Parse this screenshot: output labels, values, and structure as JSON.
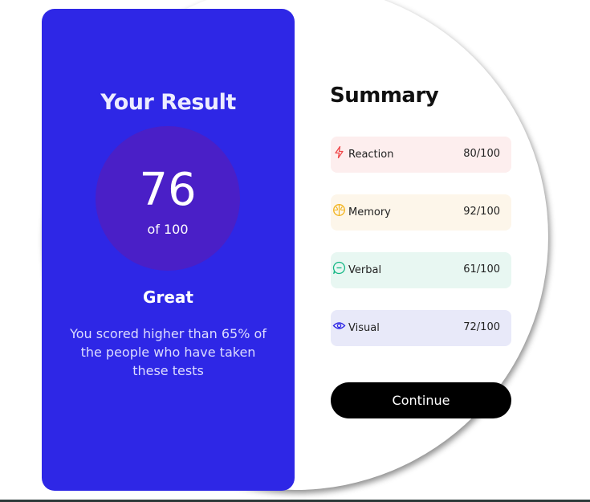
{
  "result": {
    "title": "Your Result",
    "score": "76",
    "score_of": "of 100",
    "rating": "Great",
    "description": "You scored higher than 65% of the people who have taken these tests",
    "panel_color": "#2e27e6",
    "circle_color": "#4a1fc7"
  },
  "summary": {
    "title": "Summary",
    "items": [
      {
        "label": "Reaction",
        "score": "80/100",
        "icon": "lightning-icon",
        "color": "#f0484a",
        "bg": "#fdeeee"
      },
      {
        "label": "Memory",
        "score": "92/100",
        "icon": "brain-icon",
        "color": "#f2b31c",
        "bg": "#fdf6ea"
      },
      {
        "label": "Verbal",
        "score": "61/100",
        "icon": "chat-icon",
        "color": "#17b886",
        "bg": "#e8f7f2"
      },
      {
        "label": "Visual",
        "score": "72/100",
        "icon": "eye-icon",
        "color": "#2e27e6",
        "bg": "#e8e9f9"
      }
    ]
  },
  "continue_label": "Continue"
}
